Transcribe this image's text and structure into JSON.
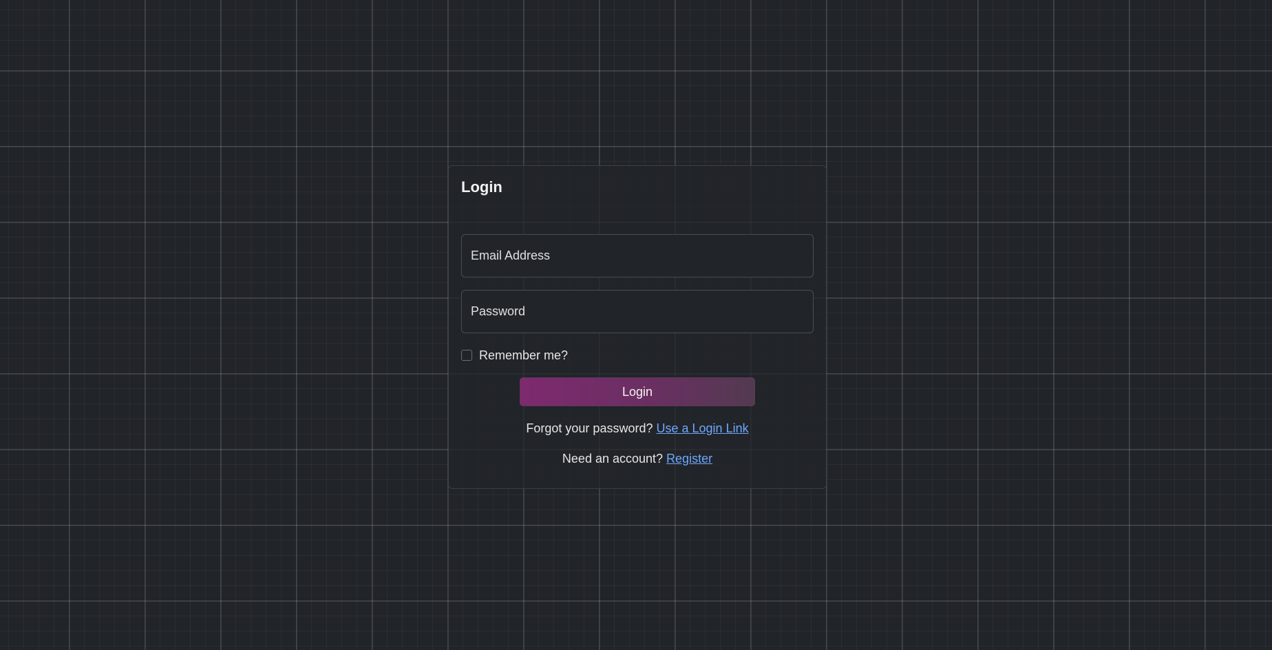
{
  "login_card": {
    "title": "Login",
    "email_placeholder": "Email Address",
    "password_placeholder": "Password",
    "remember_label": "Remember me?",
    "login_button": "Login",
    "forgot_text": "Forgot your password?",
    "login_link_text": "Use a Login Link",
    "need_account_text": "Need an account?",
    "register_link_text": "Register"
  },
  "colors": {
    "background": "#212429",
    "accent_gradient_start": "#7e2a6f",
    "accent_gradient_end": "#533a50",
    "link": "#6ea8fe"
  }
}
